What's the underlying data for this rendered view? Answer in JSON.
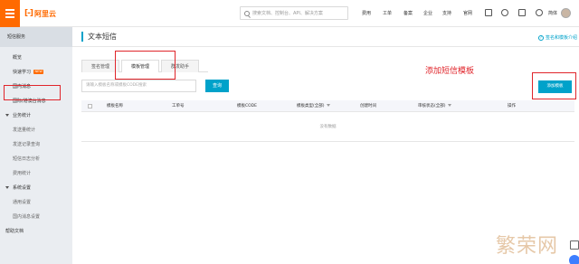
{
  "topbar": {
    "logo_text": "阿里云",
    "search_placeholder": "搜索文档、控制台、API、解决方案",
    "links": [
      "费用",
      "工单",
      "备案",
      "企业",
      "支持",
      "官网"
    ],
    "lang": "简体"
  },
  "sidebar": {
    "header": "短信服务",
    "items": [
      {
        "label": "概览",
        "type": "item"
      },
      {
        "label": "快速学习",
        "type": "item",
        "badge": "NEW"
      },
      {
        "label": "国内消息",
        "type": "item"
      },
      {
        "label": "国际/港澳台消息",
        "type": "item"
      },
      {
        "label": "业务统计",
        "type": "group"
      },
      {
        "label": "发送量统计",
        "type": "sub"
      },
      {
        "label": "发送记录查询",
        "type": "sub"
      },
      {
        "label": "短信日志分析",
        "type": "sub"
      },
      {
        "label": "费用统计",
        "type": "sub"
      },
      {
        "label": "系统设置",
        "type": "group"
      },
      {
        "label": "通用设置",
        "type": "sub"
      },
      {
        "label": "国内消息设置",
        "type": "sub"
      },
      {
        "label": "帮助文档",
        "type": "item"
      }
    ]
  },
  "main": {
    "title": "文本短信",
    "help_link": "签名和模板介绍",
    "tabs": [
      "签名管理",
      "模板管理",
      "群发助手"
    ],
    "active_tab": 1,
    "filter_placeholder": "请输入模板名称或模板CODE搜索",
    "query_button": "查询",
    "add_button": "添加模板",
    "annotation": "添加短信模板",
    "table": {
      "columns": [
        "模板名称",
        "工单号",
        "模板CODE",
        "模板类型(全部)",
        "创建时间",
        "审核状态(全部)",
        "操作"
      ],
      "empty_text": "没有数据"
    }
  },
  "watermark": "繁荣网",
  "colors": {
    "brand": "#ff6a00",
    "primary": "#00a2ca",
    "highlight": "#e0252b"
  }
}
